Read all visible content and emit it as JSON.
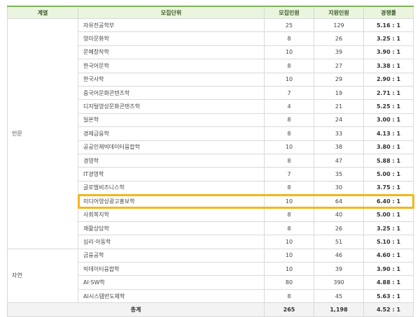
{
  "headers": {
    "category": "계열",
    "unit": "모집단위",
    "recruit": "모집인원",
    "applicants": "지원인원",
    "rate": "경쟁률"
  },
  "groups": [
    {
      "name": "인문",
      "rows": [
        {
          "unit": "자유전공학부",
          "recruit": "25",
          "applicants": "129",
          "rate": "5.16 : 1"
        },
        {
          "unit": "영미문화학",
          "recruit": "8",
          "applicants": "26",
          "rate": "3.25 : 1"
        },
        {
          "unit": "문예창작학",
          "recruit": "10",
          "applicants": "39",
          "rate": "3.90 : 1"
        },
        {
          "unit": "한국어문학",
          "recruit": "8",
          "applicants": "27",
          "rate": "3.38 : 1"
        },
        {
          "unit": "한국사학",
          "recruit": "10",
          "applicants": "29",
          "rate": "2.90 : 1"
        },
        {
          "unit": "중국어문화콘텐츠학",
          "recruit": "7",
          "applicants": "19",
          "rate": "2.71 : 1"
        },
        {
          "unit": "디지털영상문화콘텐츠학",
          "recruit": "4",
          "applicants": "21",
          "rate": "5.25 : 1"
        },
        {
          "unit": "일본학",
          "recruit": "8",
          "applicants": "24",
          "rate": "3.00 : 1"
        },
        {
          "unit": "경제금융학",
          "recruit": "8",
          "applicants": "33",
          "rate": "4.13 : 1"
        },
        {
          "unit": "공공인재빅데이터융합학",
          "recruit": "10",
          "applicants": "38",
          "rate": "3.80 : 1"
        },
        {
          "unit": "경영학",
          "recruit": "8",
          "applicants": "47",
          "rate": "5.88 : 1"
        },
        {
          "unit": "IT경영학",
          "recruit": "7",
          "applicants": "35",
          "rate": "5.00 : 1"
        },
        {
          "unit": "글로벌비즈니스학",
          "recruit": "8",
          "applicants": "30",
          "rate": "3.75 : 1"
        },
        {
          "unit": "미디어영상광고홍보학",
          "recruit": "10",
          "applicants": "64",
          "rate": "6.40 : 1"
        },
        {
          "unit": "사회복지학",
          "recruit": "8",
          "applicants": "40",
          "rate": "5.00 : 1"
        },
        {
          "unit": "재활상담학",
          "recruit": "8",
          "applicants": "26",
          "rate": "3.25 : 1"
        },
        {
          "unit": "심리·아동학",
          "recruit": "10",
          "applicants": "51",
          "rate": "5.10 : 1"
        }
      ]
    },
    {
      "name": "자연",
      "rows": [
        {
          "unit": "금융공학",
          "recruit": "10",
          "applicants": "46",
          "rate": "4.60 : 1"
        },
        {
          "unit": "빅데이터융합학",
          "recruit": "10",
          "applicants": "39",
          "rate": "3.90 : 1"
        },
        {
          "unit": "AI·SW학",
          "recruit": "80",
          "applicants": "390",
          "rate": "4.88 : 1"
        },
        {
          "unit": "AI시스템반도체학",
          "recruit": "8",
          "applicants": "45",
          "rate": "5.63 : 1"
        }
      ]
    }
  ],
  "total": {
    "label": "총계",
    "recruit": "265",
    "applicants": "1,198",
    "rate": "4.52 : 1"
  },
  "highlight_row": "미디어영상광고홍보학",
  "colors": {
    "header_bg": "#eaf4df",
    "header_border": "#7fb05a",
    "highlight": "#f4b619",
    "footer_bg": "#f3f3f3"
  }
}
